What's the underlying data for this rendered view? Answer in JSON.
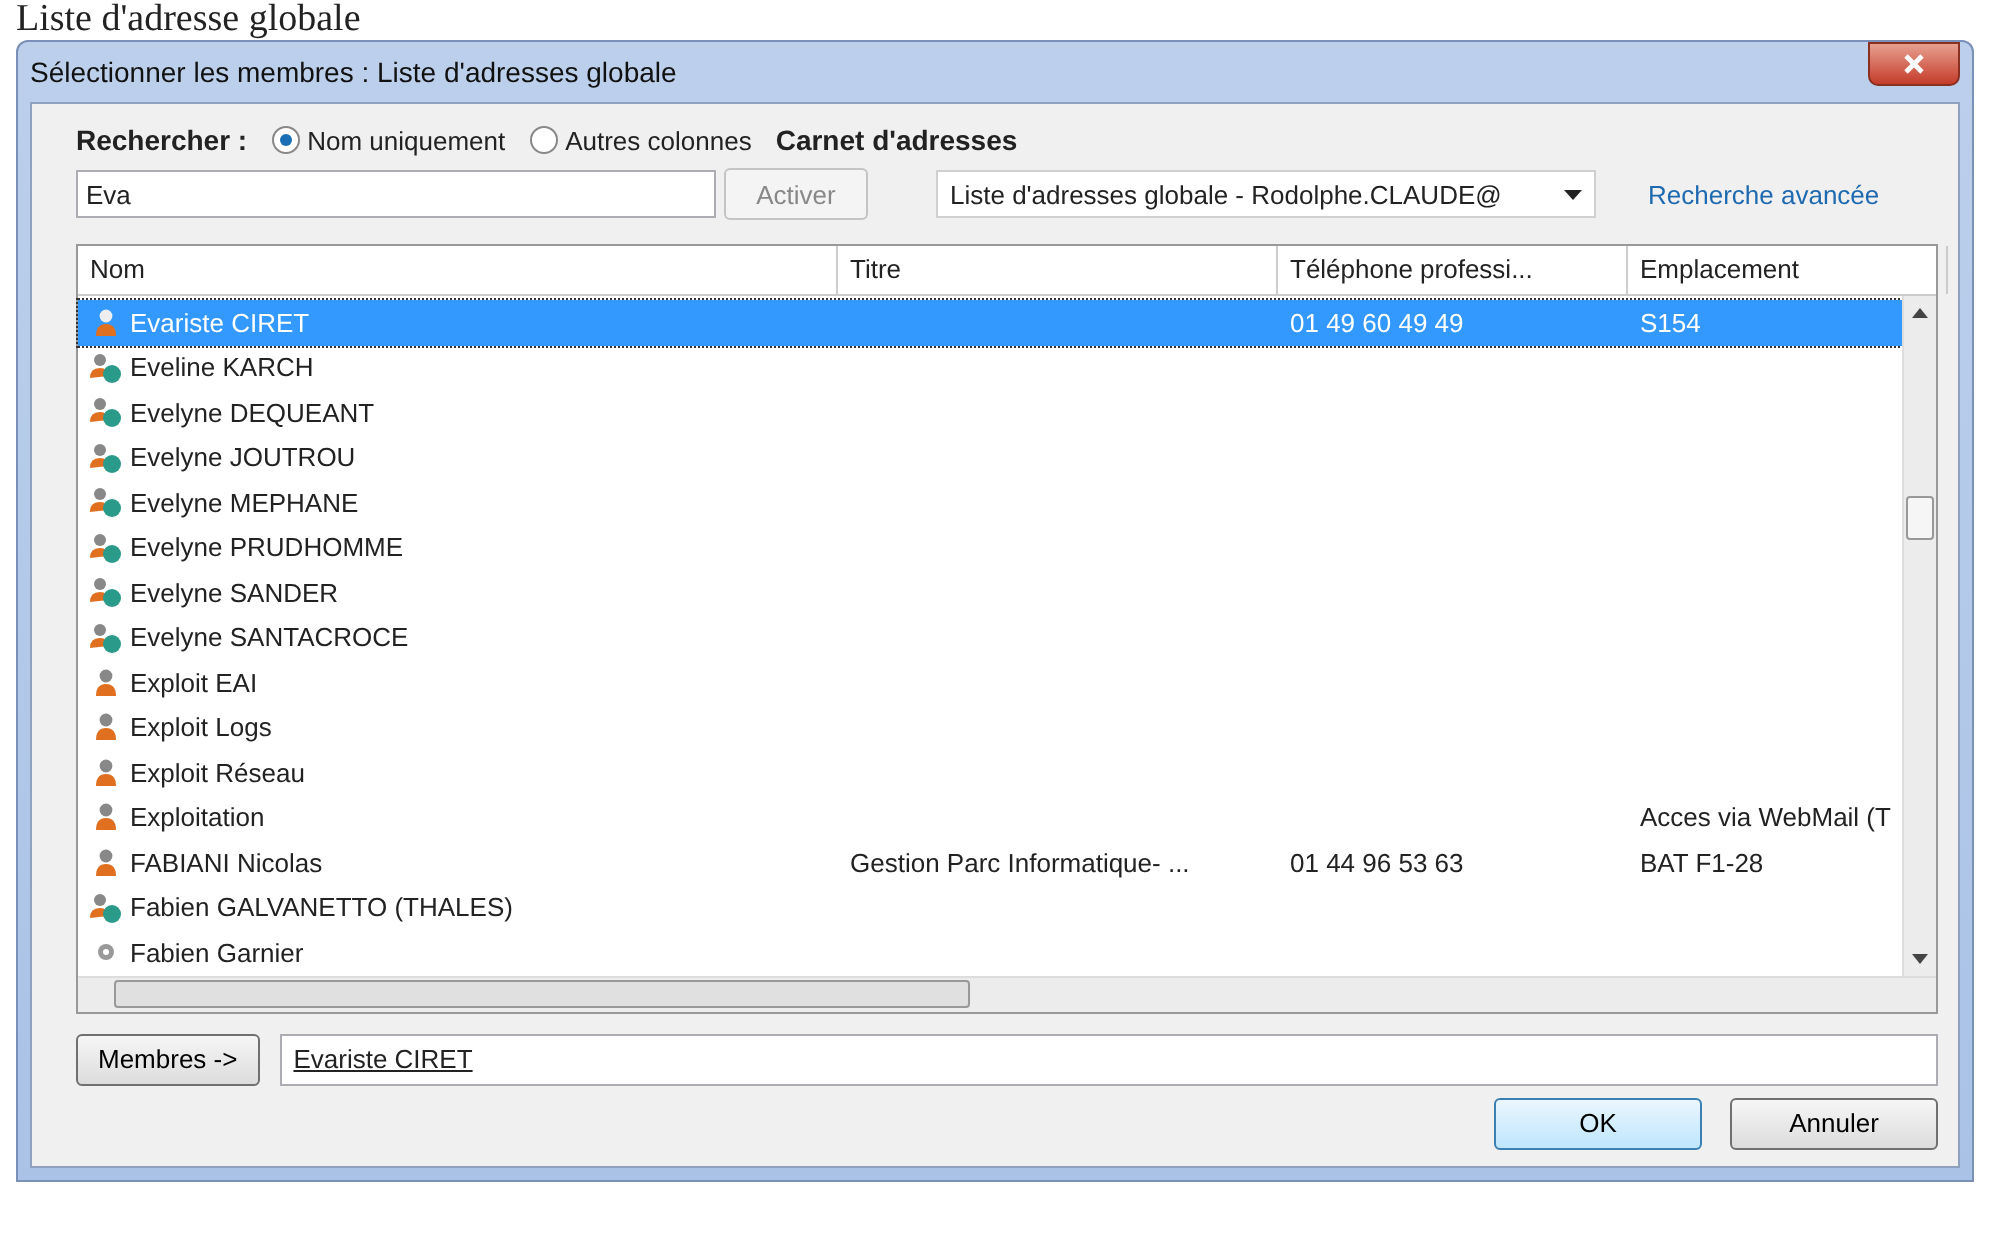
{
  "page_heading": "Liste d'adresse globale",
  "window": {
    "title": "Sélectionner les membres : Liste d'adresses globale"
  },
  "search": {
    "label": "Rechercher :",
    "options": [
      {
        "label": "Nom uniquement",
        "selected": true
      },
      {
        "label": "Autres colonnes",
        "selected": false
      }
    ],
    "value": "Eva",
    "button": "Activer"
  },
  "address_book": {
    "label": "Carnet d'adresses",
    "value": "Liste d'adresses globale - Rodolphe.CLAUDE@",
    "advanced_link": "Recherche avancée"
  },
  "table": {
    "columns": [
      "Nom",
      "Titre",
      "Téléphone professi...",
      "Emplacement"
    ],
    "rows": [
      {
        "kind": "user",
        "selected": true,
        "cells": [
          "Evariste CIRET",
          "",
          "01 49 60 49 49",
          "S154"
        ]
      },
      {
        "kind": "contact",
        "selected": false,
        "cells": [
          "Eveline KARCH",
          "",
          "",
          ""
        ]
      },
      {
        "kind": "contact",
        "selected": false,
        "cells": [
          "Evelyne DEQUEANT",
          "",
          "",
          ""
        ]
      },
      {
        "kind": "contact",
        "selected": false,
        "cells": [
          "Evelyne JOUTROU",
          "",
          "",
          ""
        ]
      },
      {
        "kind": "contact",
        "selected": false,
        "cells": [
          "Evelyne MEPHANE",
          "",
          "",
          ""
        ]
      },
      {
        "kind": "contact",
        "selected": false,
        "cells": [
          "Evelyne PRUDHOMME",
          "",
          "",
          ""
        ]
      },
      {
        "kind": "contact",
        "selected": false,
        "cells": [
          "Evelyne SANDER",
          "",
          "",
          ""
        ]
      },
      {
        "kind": "contact",
        "selected": false,
        "cells": [
          "Evelyne SANTACROCE",
          "",
          "",
          ""
        ]
      },
      {
        "kind": "user",
        "selected": false,
        "cells": [
          "Exploit EAI",
          "",
          "",
          ""
        ]
      },
      {
        "kind": "user",
        "selected": false,
        "cells": [
          "Exploit Logs",
          "",
          "",
          ""
        ]
      },
      {
        "kind": "user",
        "selected": false,
        "cells": [
          "Exploit Réseau",
          "",
          "",
          ""
        ]
      },
      {
        "kind": "user",
        "selected": false,
        "cells": [
          "Exploitation",
          "",
          "",
          "Acces via WebMail (T"
        ]
      },
      {
        "kind": "user",
        "selected": false,
        "cells": [
          "FABIANI Nicolas",
          "Gestion Parc Informatique- ...",
          "01 44 96 53 63",
          "BAT F1-28"
        ]
      },
      {
        "kind": "contact",
        "selected": false,
        "cells": [
          "Fabien GALVANETTO (THALES)",
          "",
          "",
          ""
        ]
      },
      {
        "kind": "other",
        "selected": false,
        "cells": [
          "Fabien Garnier",
          "",
          "",
          ""
        ]
      }
    ]
  },
  "members": {
    "button": "Membres ->",
    "value": "Evariste CIRET"
  },
  "buttons": [
    "OK",
    "Annuler"
  ]
}
